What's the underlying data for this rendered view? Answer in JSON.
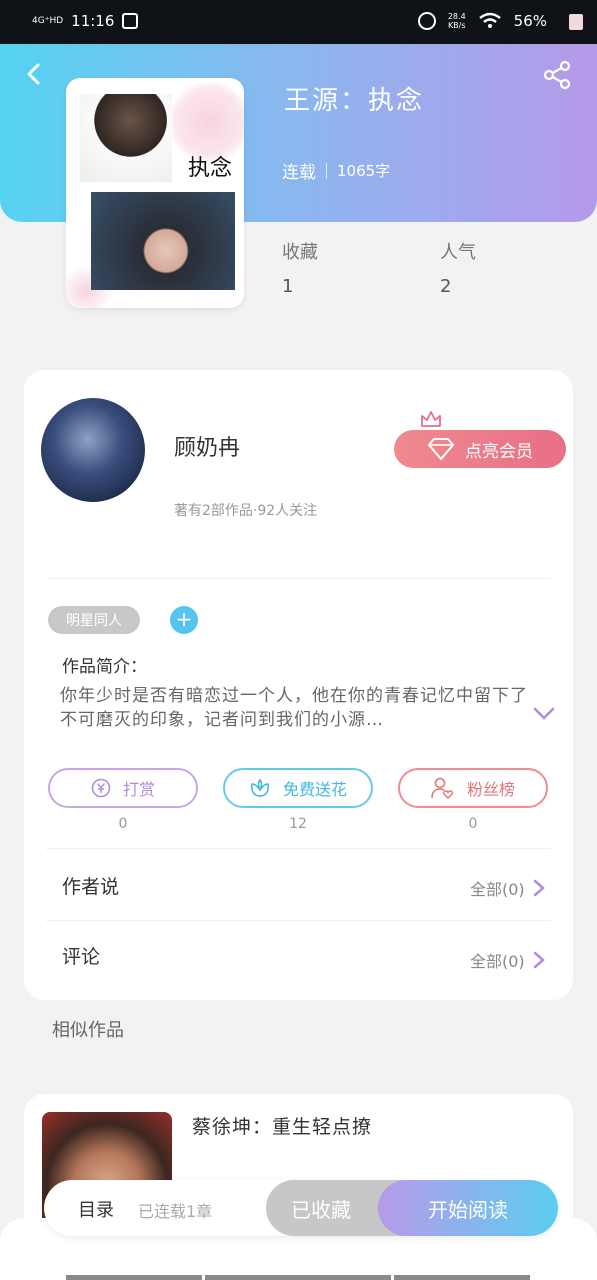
{
  "status_bar": {
    "network": "4G⁺HD",
    "time": "11:16",
    "speed_value": "28.4",
    "speed_unit": "KB/s",
    "battery": "56%"
  },
  "book": {
    "title": "王源：执念",
    "cover_title": "执念",
    "status": "连载",
    "word_count": "1065字",
    "favorites_label": "收藏",
    "favorites_value": "1",
    "popularity_label": "人气",
    "popularity_value": "2"
  },
  "author": {
    "name": "顾奶冉",
    "stats": "著有2部作品·92人关注",
    "vip_label": "点亮会员"
  },
  "tags": [
    "明星同人"
  ],
  "intro": {
    "label": "作品简介：",
    "text": "你年少时是否有暗恋过一个人，他在你的青春记忆中留下了不可磨灭的印象，记者问到我们的小源…"
  },
  "actions": {
    "reward": {
      "label": "打赏",
      "count": "0"
    },
    "flower": {
      "label": "免费送花",
      "count": "12"
    },
    "fans": {
      "label": "粉丝榜",
      "count": "0"
    }
  },
  "rows": {
    "author_says": {
      "label": "作者说",
      "right": "全部(0)"
    },
    "comments": {
      "label": "评论",
      "right": "全部(0)"
    }
  },
  "similar": {
    "label": "相似作品",
    "items": [
      {
        "title": "蔡徐坤：重生轻点撩"
      }
    ]
  },
  "bottom": {
    "toc": "目录",
    "progress": "已连载1章",
    "collected": "已收藏",
    "read": "开始阅读"
  },
  "colors": {
    "header_start": "#55d3f0",
    "header_end": "#b59ae9",
    "vip": "#e76f87",
    "accent_blue": "#55c4ee"
  }
}
